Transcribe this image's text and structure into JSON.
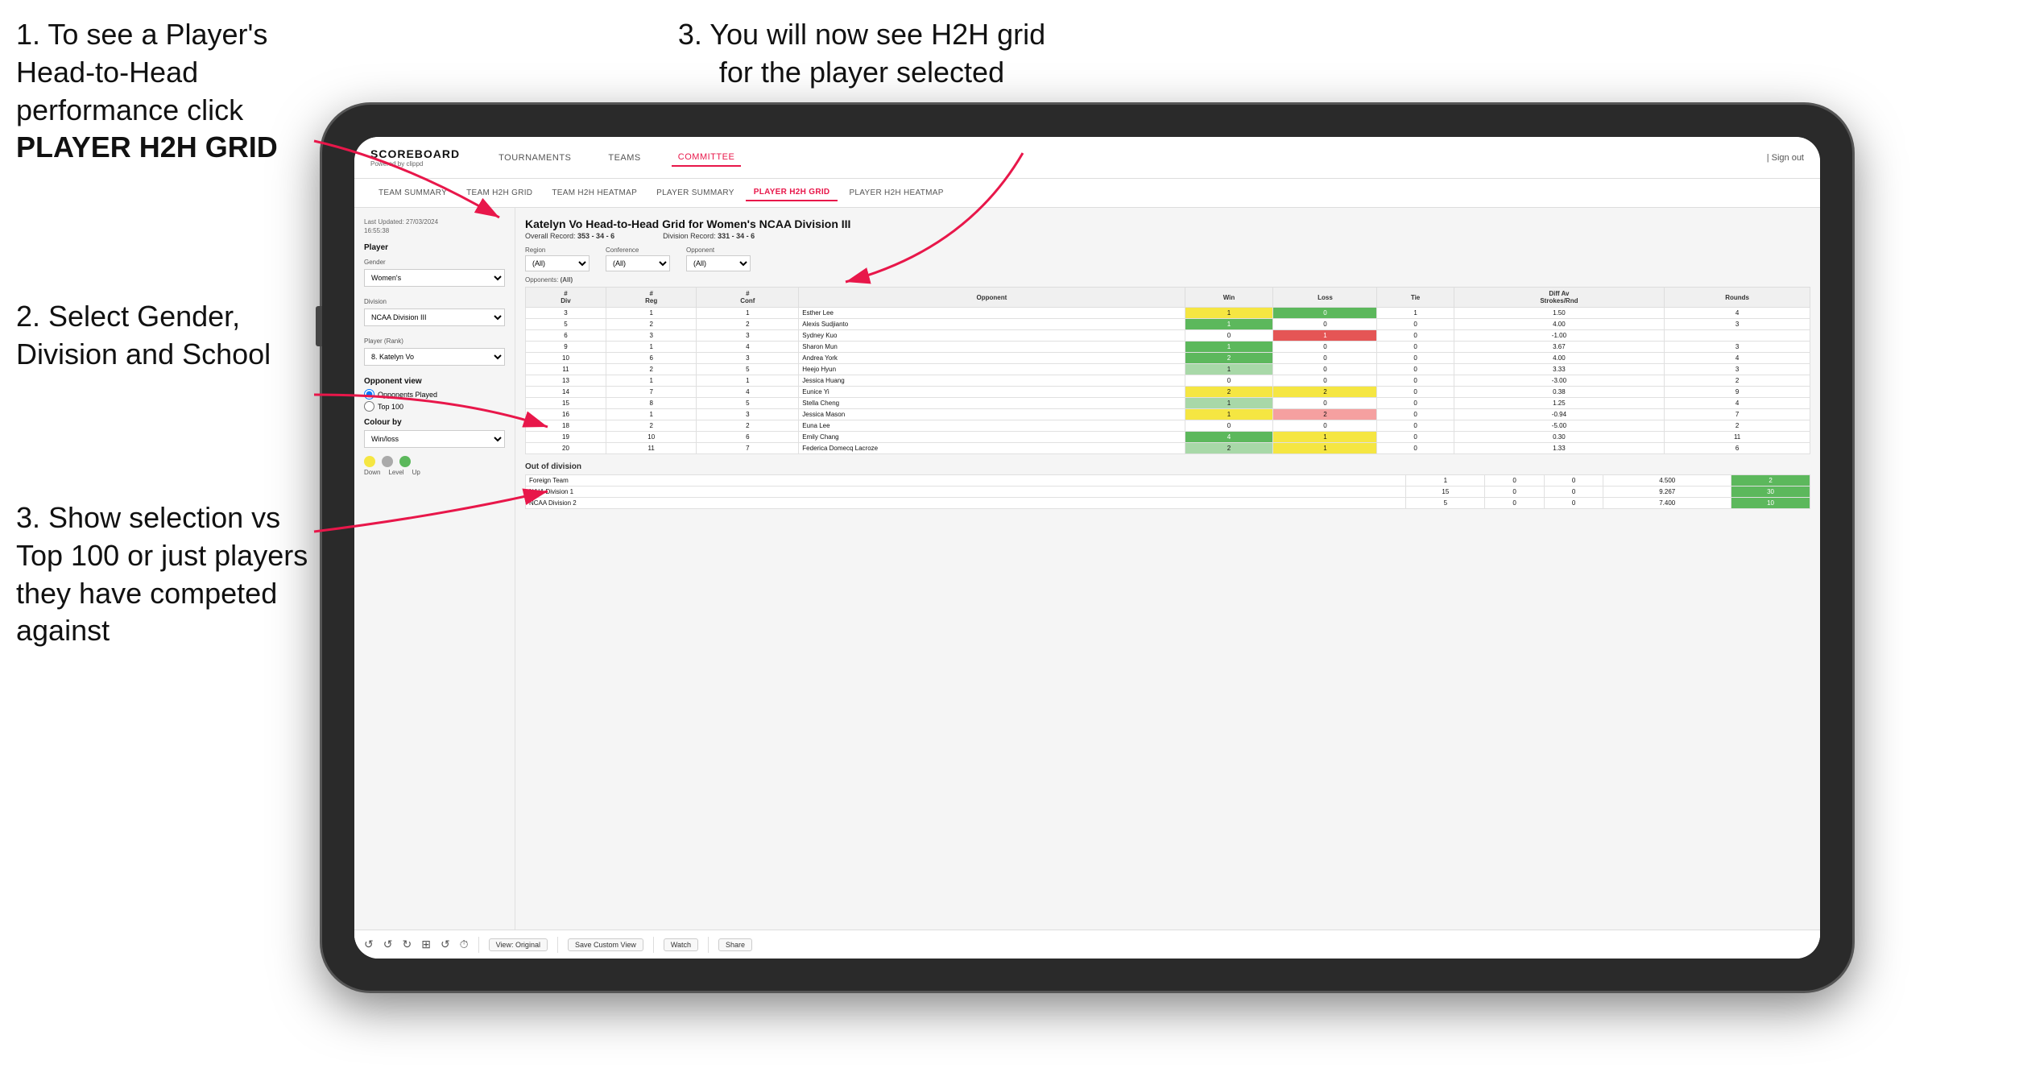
{
  "instructions": {
    "step1": "1. To see a Player's Head-to-Head performance click",
    "step1_bold": "PLAYER H2H GRID",
    "step3_top": "3. You will now see H2H grid for the player selected",
    "step2": "2. Select Gender, Division and School",
    "step3_bottom": "3. Show selection vs Top 100 or just players they have competed against"
  },
  "nav": {
    "logo_main": "SCOREBOARD",
    "logo_sub": "Powered by clippd",
    "items": [
      "TOURNAMENTS",
      "TEAMS",
      "COMMITTEE"
    ],
    "active": "COMMITTEE",
    "sign_out": "Sign out"
  },
  "sub_nav": {
    "items": [
      "TEAM SUMMARY",
      "TEAM H2H GRID",
      "TEAM H2H HEATMAP",
      "PLAYER SUMMARY",
      "PLAYER H2H GRID",
      "PLAYER H2H HEATMAP"
    ],
    "active": "PLAYER H2H GRID"
  },
  "sidebar": {
    "timestamp": "Last Updated: 27/03/2024\n16:55:38",
    "player_label": "Player",
    "gender_label": "Gender",
    "gender_value": "Women's",
    "division_label": "Division",
    "division_value": "NCAA Division III",
    "player_rank_label": "Player (Rank)",
    "player_rank_value": "8. Katelyn Vo",
    "opponent_view_label": "Opponent view",
    "radio_played": "Opponents Played",
    "radio_top100": "Top 100",
    "colour_by_label": "Colour by",
    "colour_value": "Win/loss",
    "colours": [
      {
        "color": "#f5e642",
        "label": "Down"
      },
      {
        "color": "#aaaaaa",
        "label": "Level"
      },
      {
        "color": "#5cb85c",
        "label": "Up"
      }
    ]
  },
  "grid": {
    "title": "Katelyn Vo Head-to-Head Grid for Women's NCAA Division III",
    "overall_record_label": "Overall Record:",
    "overall_record": "353 - 34 - 6",
    "division_record_label": "Division Record:",
    "division_record": "331 - 34 - 6",
    "filters": {
      "opponents_label": "Opponents:",
      "region_label": "Region",
      "conference_label": "Conference",
      "opponent_label": "Opponent",
      "region_value": "(All)",
      "conference_value": "(All)",
      "opponent_value": "(All)"
    },
    "table_headers": [
      "# Div",
      "# Reg",
      "# Conf",
      "Opponent",
      "Win",
      "Loss",
      "Tie",
      "Diff Av Strokes/Rnd",
      "Rounds"
    ],
    "rows": [
      {
        "div": 3,
        "reg": 1,
        "conf": 1,
        "opponent": "Esther Lee",
        "win": 1,
        "loss": 0,
        "tie": 1,
        "diff": "1.50",
        "rounds": 4,
        "win_color": "yellow",
        "loss_color": "green"
      },
      {
        "div": 5,
        "reg": 2,
        "conf": 2,
        "opponent": "Alexis Sudjianto",
        "win": 1,
        "loss": 0,
        "tie": 0,
        "diff": "4.00",
        "rounds": 3,
        "win_color": "green",
        "loss_color": ""
      },
      {
        "div": 6,
        "reg": 3,
        "conf": 3,
        "opponent": "Sydney Kuo",
        "win": 0,
        "loss": 1,
        "tie": 0,
        "diff": "-1.00",
        "rounds": "",
        "win_color": "",
        "loss_color": "red"
      },
      {
        "div": 9,
        "reg": 1,
        "conf": 4,
        "opponent": "Sharon Mun",
        "win": 1,
        "loss": 0,
        "tie": 0,
        "diff": "3.67",
        "rounds": 3,
        "win_color": "green",
        "loss_color": ""
      },
      {
        "div": 10,
        "reg": 6,
        "conf": 3,
        "opponent": "Andrea York",
        "win": 2,
        "loss": 0,
        "tie": 0,
        "diff": "4.00",
        "rounds": 4,
        "win_color": "green",
        "loss_color": ""
      },
      {
        "div": 11,
        "reg": 2,
        "conf": 5,
        "opponent": "Heejo Hyun",
        "win": 1,
        "loss": 0,
        "tie": 0,
        "diff": "3.33",
        "rounds": 3,
        "win_color": "light-green",
        "loss_color": ""
      },
      {
        "div": 13,
        "reg": 1,
        "conf": 1,
        "opponent": "Jessica Huang",
        "win": 0,
        "loss": 0,
        "tie": 0,
        "diff": "-3.00",
        "rounds": 2,
        "win_color": "",
        "loss_color": ""
      },
      {
        "div": 14,
        "reg": 7,
        "conf": 4,
        "opponent": "Eunice Yi",
        "win": 2,
        "loss": 2,
        "tie": 0,
        "diff": "0.38",
        "rounds": 9,
        "win_color": "yellow",
        "loss_color": "yellow"
      },
      {
        "div": 15,
        "reg": 8,
        "conf": 5,
        "opponent": "Stella Cheng",
        "win": 1,
        "loss": 0,
        "tie": 0,
        "diff": "1.25",
        "rounds": 4,
        "win_color": "light-green",
        "loss_color": ""
      },
      {
        "div": 16,
        "reg": 1,
        "conf": 3,
        "opponent": "Jessica Mason",
        "win": 1,
        "loss": 2,
        "tie": 0,
        "diff": "-0.94",
        "rounds": 7,
        "win_color": "yellow",
        "loss_color": "light-red"
      },
      {
        "div": 18,
        "reg": 2,
        "conf": 2,
        "opponent": "Euna Lee",
        "win": 0,
        "loss": 0,
        "tie": 0,
        "diff": "-5.00",
        "rounds": 2,
        "win_color": "",
        "loss_color": ""
      },
      {
        "div": 19,
        "reg": 10,
        "conf": 6,
        "opponent": "Emily Chang",
        "win": 4,
        "loss": 1,
        "tie": 0,
        "diff": "0.30",
        "rounds": 11,
        "win_color": "green",
        "loss_color": "yellow"
      },
      {
        "div": 20,
        "reg": 11,
        "conf": 7,
        "opponent": "Federica Domecq Lacroze",
        "win": 2,
        "loss": 1,
        "tie": 0,
        "diff": "1.33",
        "rounds": 6,
        "win_color": "light-green",
        "loss_color": "yellow"
      }
    ],
    "out_of_division_label": "Out of division",
    "out_of_division_rows": [
      {
        "label": "Foreign Team",
        "win": 1,
        "loss": 0,
        "tie": 0,
        "diff": "4.500",
        "rounds": 2
      },
      {
        "label": "NAIA Division 1",
        "win": 15,
        "loss": 0,
        "tie": 0,
        "diff": "9.267",
        "rounds": 30
      },
      {
        "label": "NCAA Division 2",
        "win": 5,
        "loss": 0,
        "tie": 0,
        "diff": "7.400",
        "rounds": 10
      }
    ]
  },
  "toolbar": {
    "view_original": "View: Original",
    "save_custom": "Save Custom View",
    "watch": "Watch",
    "share": "Share"
  }
}
